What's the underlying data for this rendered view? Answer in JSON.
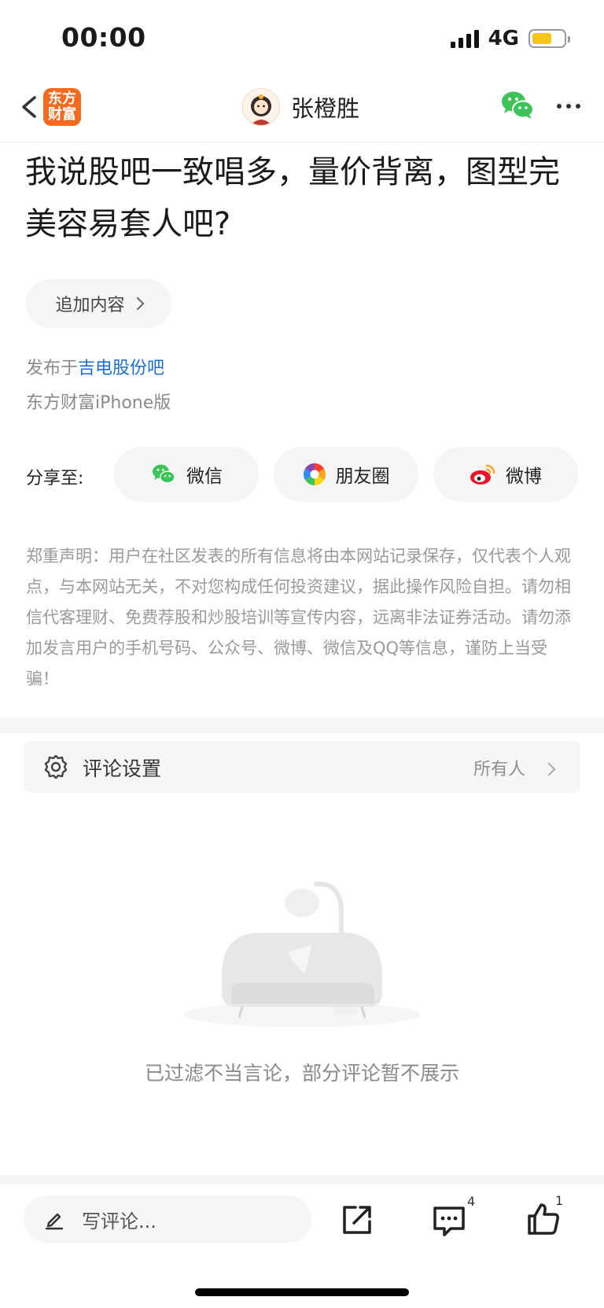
{
  "status": {
    "time": "00:00",
    "network": "4G"
  },
  "header": {
    "logo_line1": "东方",
    "logo_line2": "财富",
    "author_name": "张橙胜"
  },
  "post": {
    "title": "我说股吧一致唱多，量价背离，图型完美容易套人吧?",
    "append_label": "追加内容",
    "published_prefix": "发布于",
    "bar_name": "吉电股份吧",
    "device": "东方财富iPhone版"
  },
  "share": {
    "label": "分享至:",
    "targets": [
      {
        "label": "微信",
        "icon": "wechat-icon"
      },
      {
        "label": "朋友圈",
        "icon": "moments-icon"
      },
      {
        "label": "微博",
        "icon": "weibo-icon"
      }
    ]
  },
  "disclaimer": "郑重声明：用户在社区发表的所有信息将由本网站记录保存，仅代表个人观点，与本网站无关，不对您构成任何投资建议，据此操作风险自担。请勿相信代客理财、免费荐股和炒股培训等宣传内容，远离非法证券活动。请勿添加发言用户的手机号码、公众号、微博、微信及QQ等信息，谨防上当受骗！",
  "comment_settings": {
    "label": "评论设置",
    "value": "所有人"
  },
  "empty": {
    "text": "已过滤不当言论，部分评论暂不展示"
  },
  "bottom_bar": {
    "placeholder": "写评论...",
    "comment_count": "4",
    "like_count": "1"
  },
  "colors": {
    "brand": "#f46a1f",
    "link": "#1a6fd1",
    "wechat": "#3dc35a",
    "weibo": "#e6162d"
  }
}
